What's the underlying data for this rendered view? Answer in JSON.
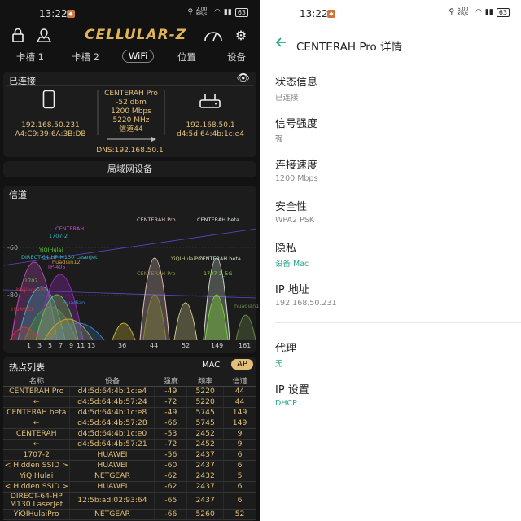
{
  "status_bar": {
    "time": "13:22",
    "speed_left": "2.00 KB/s",
    "speed_right": "5.00 KB/s",
    "battery": "63"
  },
  "app": {
    "name": "CELLULAR-Z"
  },
  "tabs": [
    {
      "label": "卡槽 1"
    },
    {
      "label": "卡槽 2"
    },
    {
      "label": "WiFi"
    },
    {
      "label": "位置"
    },
    {
      "label": "设备"
    }
  ],
  "connected": {
    "title": "已连接",
    "phone_ip": "192.168.50.231",
    "phone_mac": "A4:C9:39:6A:3B:DB",
    "ssid": "CENTERAH Pro",
    "signal": "-52 dbm",
    "speed": "1200 Mbps",
    "freq": "5220 MHz",
    "channel": "信道44",
    "router_ip": "192.168.50.1",
    "router_mac": "d4:5d:64:4b:1c:e4",
    "dns": "DNS:192.168.50.1"
  },
  "lan_button": "局域网设备",
  "channel_panel": {
    "title": "信道",
    "y_ticks": [
      "-60",
      "-80"
    ],
    "x_ticks": [
      "1",
      "3",
      "5",
      "7",
      "9",
      "11",
      "13",
      "36",
      "44",
      "52",
      "149",
      "161"
    ],
    "labels_24": [
      "CENTERAH",
      "1707-2",
      "YiQIHulai",
      "DIRECT-64-HP M130 LaserJet",
      "huadian12",
      "TP-405",
      "1707",
      "beijingcaib",
      "huadian",
      "HUAWEI"
    ],
    "labels_5": [
      "CENTERAH Pro",
      "CENTERAH beta",
      "YiQIHulaiPro",
      "CENTERAH beta",
      "CENTERAH Pro",
      "1707-2_5G",
      "huadian12"
    ]
  },
  "hotspot": {
    "title": "热点列表",
    "mac_btn": "MAC",
    "ap_btn": "AP",
    "columns": [
      "名称",
      "设备",
      "强度",
      "频率",
      "信道"
    ],
    "rows": [
      [
        "CENTERAH Pro",
        "d4:5d:64:4b:1c:e4",
        "-49",
        "5220",
        "44"
      ],
      [
        "←",
        "d4:5d:64:4b:57:24",
        "-72",
        "5220",
        "44"
      ],
      [
        "CENTERAH beta",
        "d4:5d:64:4b:1c:e8",
        "-49",
        "5745",
        "149"
      ],
      [
        "←",
        "d4:5d:64:4b:57:28",
        "-66",
        "5745",
        "149"
      ],
      [
        "CENTERAH",
        "d4:5d:64:4b:1c:e0",
        "-53",
        "2452",
        "9"
      ],
      [
        "←",
        "d4:5d:64:4b:57:21",
        "-72",
        "2452",
        "9"
      ],
      [
        "1707-2",
        "HUAWEI",
        "-56",
        "2437",
        "6"
      ],
      [
        "< Hidden SSID >",
        "HUAWEI",
        "-60",
        "2437",
        "6"
      ],
      [
        "YiQIHulai",
        "NETGEAR",
        "-62",
        "2432",
        "5"
      ],
      [
        "< Hidden SSID >",
        "HUAWEI",
        "-62",
        "2437",
        "6"
      ],
      [
        "DIRECT-64-HP M130 LaserJet",
        "12:5b:ad:02:93:64",
        "-65",
        "2437",
        "6"
      ],
      [
        "YiQIHulaiPro",
        "NETGEAR",
        "-66",
        "5260",
        "52"
      ]
    ]
  },
  "details": {
    "title": "CENTERAH Pro 详情",
    "items": [
      {
        "label": "状态信息",
        "value": "已连接"
      },
      {
        "label": "信号强度",
        "value": "强"
      },
      {
        "label": "连接速度",
        "value": "1200 Mbps"
      },
      {
        "label": "安全性",
        "value": "WPA2 PSK"
      },
      {
        "label": "隐私",
        "value": "设备 Mac"
      },
      {
        "label": "IP 地址",
        "value": "192.168.50.231"
      },
      {
        "label": "代理",
        "value": "无"
      },
      {
        "label": "IP 设置",
        "value": "DHCP"
      }
    ]
  },
  "colors": {
    "accent": "#2aa58c",
    "gold": "#e3c078",
    "panel": "#1c1c1c"
  }
}
